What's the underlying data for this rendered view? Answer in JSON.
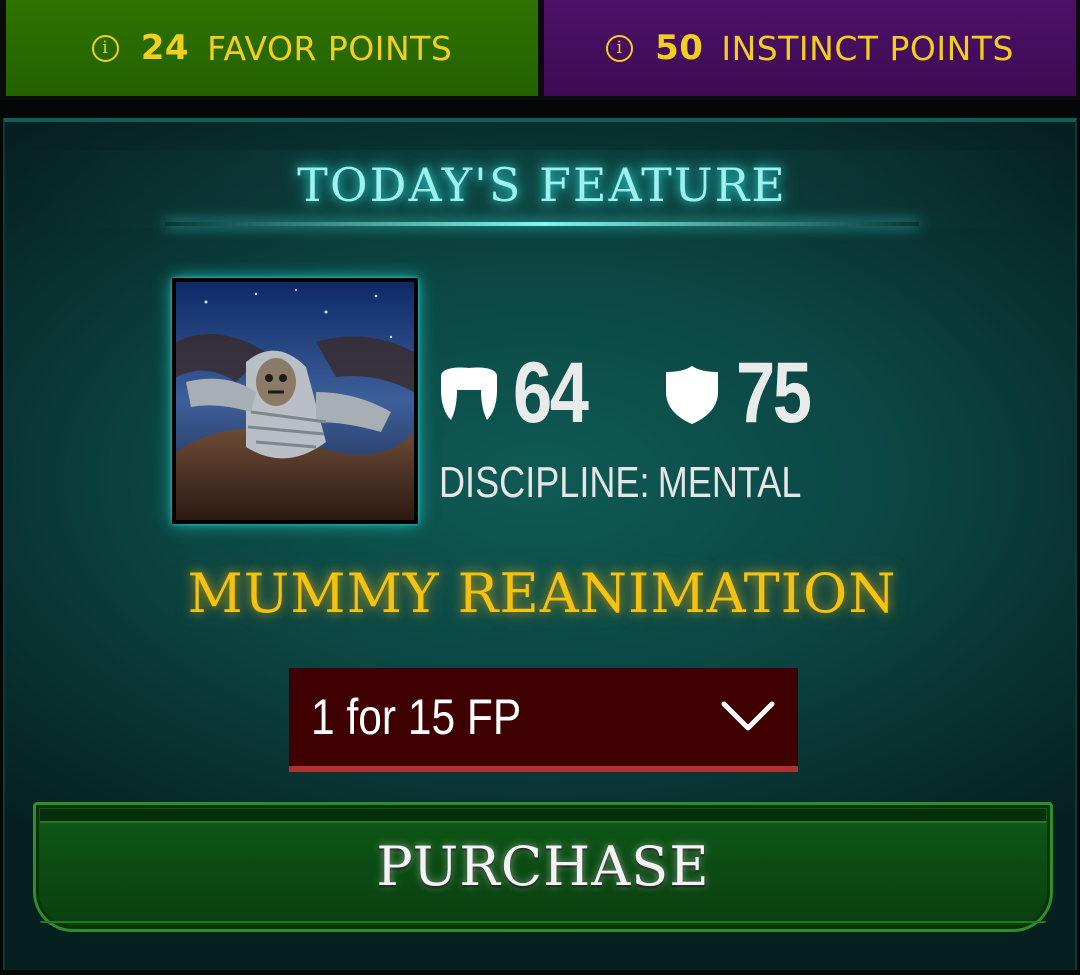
{
  "currency": {
    "favor": {
      "value": "24",
      "label": "FAVOR POINTS",
      "color": "#2e7300"
    },
    "instinct": {
      "value": "50",
      "label": "INSTINCT POINTS",
      "color": "#4d1167"
    },
    "info_glyph": "i"
  },
  "feature": {
    "title": "TODAY'S FEATURE",
    "card_name": "MUMMY REANIMATION",
    "attack": "64",
    "defense": "75",
    "discipline_label": "DISCIPLINE:",
    "discipline_value": "MENTAL",
    "portrait_icon": "mummy-portrait",
    "attack_icon": "fangs-icon",
    "defense_icon": "shield-icon"
  },
  "purchase_options": {
    "selected": "1 for 15 FP"
  },
  "actions": {
    "purchase_label": "PURCHASE"
  },
  "colors": {
    "accent_gold": "#f4c20f",
    "title_cyan": "#9ff1ee",
    "dropdown_bg": "#3e0000",
    "button_green": "#0f5a18"
  }
}
